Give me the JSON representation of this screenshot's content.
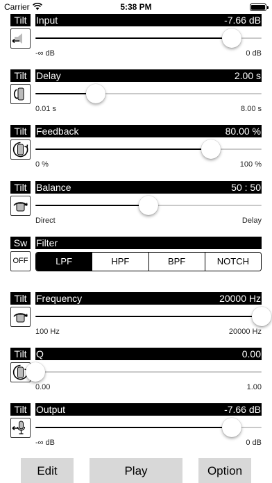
{
  "status": {
    "carrier": "Carrier",
    "time": "5:38 PM"
  },
  "params": {
    "input": {
      "mode": "Tilt",
      "name": "Input",
      "value": "-7.66 dB",
      "min": "-∞ dB",
      "max": "0 dB",
      "position": 0.868,
      "icon": "speaker-icon"
    },
    "delay": {
      "mode": "Tilt",
      "name": "Delay",
      "value": "2.00 s",
      "min": "0.01 s",
      "max": "8.00 s",
      "position": 0.267,
      "icon": "delay-tilt-icon"
    },
    "feedback": {
      "mode": "Tilt",
      "name": "Feedback",
      "value": "80.00 %",
      "min": "0 %",
      "max": "100 %",
      "position": 0.776,
      "icon": "feedback-loop-icon"
    },
    "balance": {
      "mode": "Tilt",
      "name": "Balance",
      "value": "50 : 50",
      "min": "Direct",
      "max": "Delay",
      "position": 0.5,
      "icon": "balance-tilt-icon"
    },
    "frequency": {
      "mode": "Tilt",
      "name": "Frequency",
      "value": "20000 Hz",
      "min": "100 Hz",
      "max": "20000 Hz",
      "position": 1.0,
      "icon": "frequency-tilt-icon"
    },
    "q": {
      "mode": "Tilt",
      "name": "Q",
      "value": "0.00",
      "min": "0.00",
      "max": "1.00",
      "position": 0.0,
      "icon": "q-tilt-icon"
    },
    "output": {
      "mode": "Tilt",
      "name": "Output",
      "value": "-7.66 dB",
      "min": "-∞ dB",
      "max": "0 dB",
      "position": 0.868,
      "icon": "microphone-icon"
    }
  },
  "filter": {
    "mode": "Sw",
    "name": "Filter",
    "switch_label": "OFF",
    "options": [
      "LPF",
      "HPF",
      "BPF",
      "NOTCH"
    ],
    "selected": "LPF"
  },
  "toolbar": {
    "edit": "Edit",
    "play": "Play",
    "option": "Option"
  },
  "colors": {
    "accent": "#000000",
    "track": "#c9c9c9",
    "toolbar_button": "#d8d8d8"
  }
}
